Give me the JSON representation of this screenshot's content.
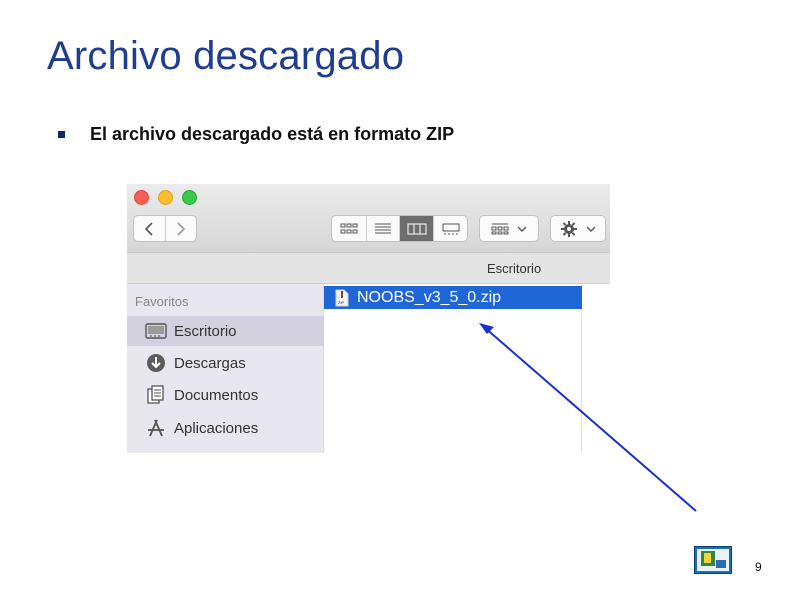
{
  "slide": {
    "title": "Archivo descargado",
    "bullet": "El archivo descargado está en formato ZIP",
    "page_number": "9"
  },
  "finder": {
    "path_label": "Escritorio",
    "sidebar": {
      "heading": "Favoritos",
      "items": [
        {
          "label": "Escritorio",
          "icon": "desktop-icon",
          "selected": true
        },
        {
          "label": "Descargas",
          "icon": "download-icon",
          "selected": false
        },
        {
          "label": "Documentos",
          "icon": "documents-icon",
          "selected": false
        },
        {
          "label": "Aplicaciones",
          "icon": "applications-icon",
          "selected": false
        }
      ]
    },
    "files": [
      {
        "name": "NOOBS_v3_5_0.zip",
        "icon": "zip-file-icon",
        "selected": true
      }
    ]
  },
  "colors": {
    "title": "#1f3d8f",
    "selection": "#1f66d6",
    "arrow": "#1a2fd0"
  }
}
